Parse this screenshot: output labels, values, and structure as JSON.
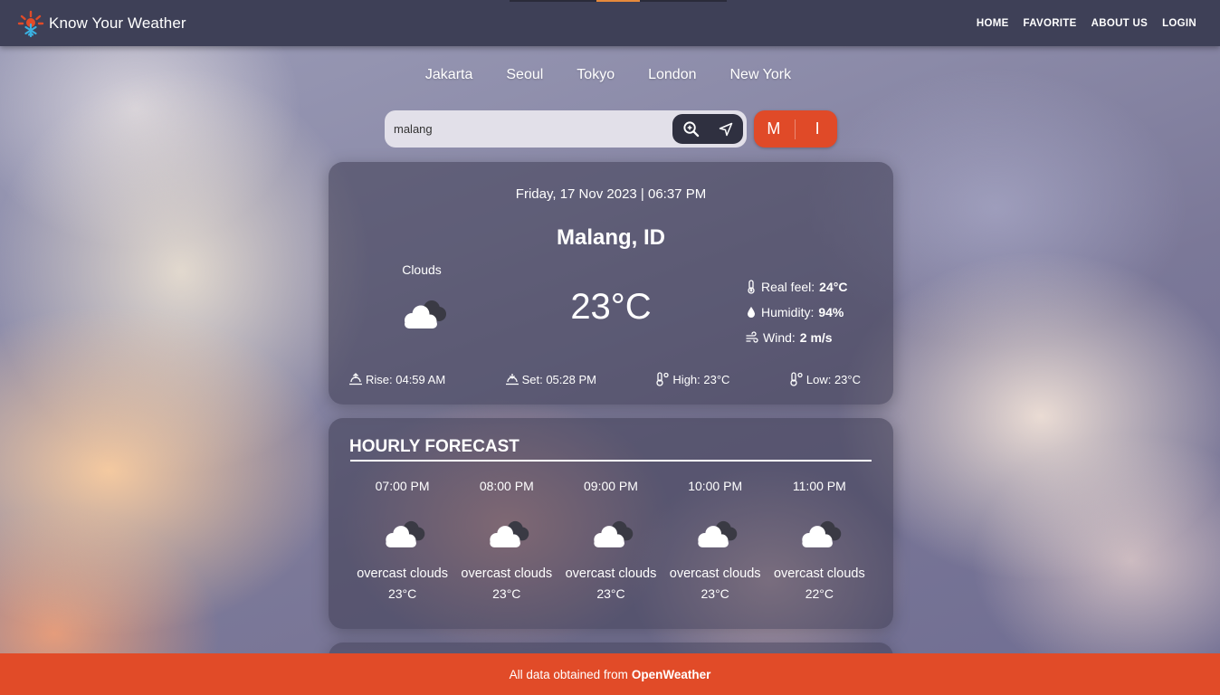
{
  "app": {
    "title": "Know Your Weather"
  },
  "nav": {
    "links": [
      "HOME",
      "FAVORITE",
      "ABOUT US",
      "LOGIN"
    ]
  },
  "cities": [
    "Jakarta",
    "Seoul",
    "Tokyo",
    "London",
    "New York"
  ],
  "search": {
    "value": "malang",
    "placeholder": ""
  },
  "units": {
    "metric": "M",
    "imperial": "I"
  },
  "current": {
    "datetime": "Friday, 17 Nov 2023 | 06:37 PM",
    "location": "Malang, ID",
    "condition": "Clouds",
    "temperature": "23°C",
    "real_feel_label": "Real feel:",
    "real_feel_value": "24°C",
    "humidity_label": "Humidity:",
    "humidity_value": "94%",
    "wind_label": "Wind:",
    "wind_value": "2 m/s",
    "rise": "Rise: 04:59 AM",
    "set": "Set: 05:28 PM",
    "high": "High: 23°C",
    "low": "Low: 23°C"
  },
  "hourly": {
    "title": "HOURLY FORECAST",
    "items": [
      {
        "time": "07:00 PM",
        "desc": "overcast clouds",
        "temp": "23°C"
      },
      {
        "time": "08:00 PM",
        "desc": "overcast clouds",
        "temp": "23°C"
      },
      {
        "time": "09:00 PM",
        "desc": "overcast clouds",
        "temp": "23°C"
      },
      {
        "time": "10:00 PM",
        "desc": "overcast clouds",
        "temp": "23°C"
      },
      {
        "time": "11:00 PM",
        "desc": "overcast clouds",
        "temp": "22°C"
      }
    ]
  },
  "footer": {
    "prefix": "All data obtained from",
    "source": "OpenWeather"
  },
  "colors": {
    "navbar": "#3e4057",
    "accent": "#e14b28",
    "search_buttons": "#2f3040"
  }
}
